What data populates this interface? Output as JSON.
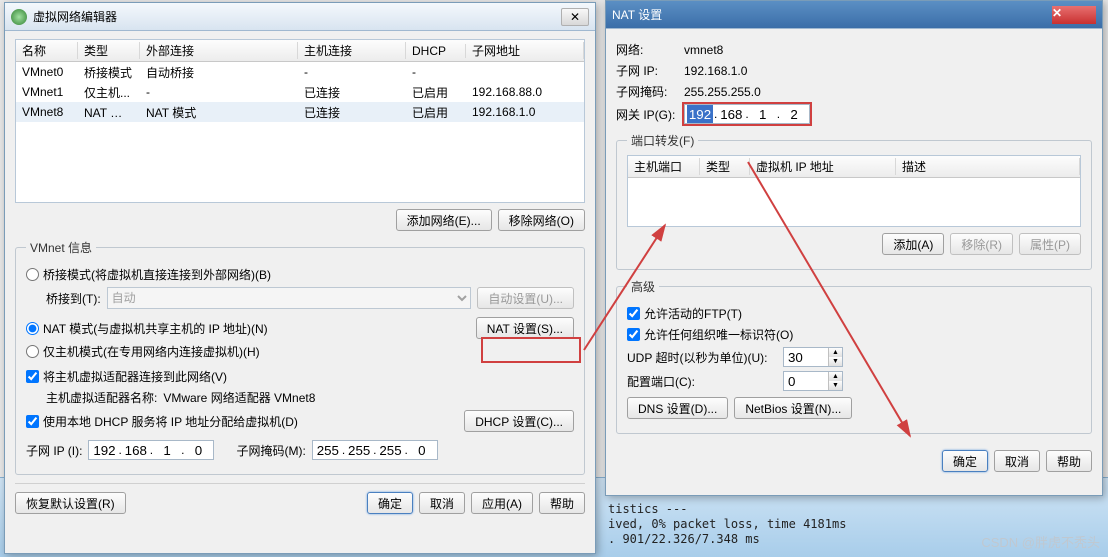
{
  "editor": {
    "title": "虚拟网络编辑器",
    "columns": {
      "name": "名称",
      "type": "类型",
      "ext": "外部连接",
      "host": "主机连接",
      "dhcp": "DHCP",
      "subnet": "子网地址"
    },
    "rows": [
      {
        "name": "VMnet0",
        "type": "桥接模式",
        "ext": "自动桥接",
        "host": "-",
        "dhcp": "-",
        "subnet": ""
      },
      {
        "name": "VMnet1",
        "type": "仅主机...",
        "ext": "-",
        "host": "已连接",
        "dhcp": "已启用",
        "subnet": "192.168.88.0"
      },
      {
        "name": "VMnet8",
        "type": "NAT 模式",
        "ext": "NAT 模式",
        "host": "已连接",
        "dhcp": "已启用",
        "subnet": "192.168.1.0"
      }
    ],
    "add_net": "添加网络(E)...",
    "del_net": "移除网络(O)",
    "info_legend": "VMnet 信息",
    "radio_bridge": "桥接模式(将虚拟机直接连接到外部网络)(B)",
    "bridge_to": "桥接到(T):",
    "bridge_auto": "自动",
    "auto_set": "自动设置(U)...",
    "radio_nat": "NAT 模式(与虚拟机共享主机的 IP 地址)(N)",
    "nat_set": "NAT 设置(S)...",
    "radio_host": "仅主机模式(在专用网络内连接虚拟机)(H)",
    "chk_connect": "将主机虚拟适配器连接到此网络(V)",
    "adapter_name_label": "主机虚拟适配器名称: ",
    "adapter_name_value": "VMware 网络适配器 VMnet8",
    "chk_dhcp": "使用本地 DHCP 服务将 IP 地址分配给虚拟机(D)",
    "dhcp_set": "DHCP 设置(C)...",
    "subnet_ip_label": "子网 IP (I):",
    "subnet_ip": [
      "192",
      "168",
      "1",
      "0"
    ],
    "subnet_mask_label": "子网掩码(M):",
    "subnet_mask": [
      "255",
      "255",
      "255",
      "0"
    ],
    "restore": "恢复默认设置(R)",
    "ok": "确定",
    "cancel": "取消",
    "apply": "应用(A)",
    "help": "帮助"
  },
  "nat": {
    "title": "NAT 设置",
    "net_label": "网络:",
    "net_value": "vmnet8",
    "subip_label": "子网 IP:",
    "subip_value": "192.168.1.0",
    "mask_label": "子网掩码:",
    "mask_value": "255.255.255.0",
    "gw_label": "网关 IP(G):",
    "gw": [
      "192",
      "168",
      "1",
      "2"
    ],
    "pf_legend": "端口转发(F)",
    "pf_cols": {
      "port": "主机端口",
      "type": "类型",
      "ip": "虚拟机 IP 地址",
      "desc": "描述"
    },
    "add": "添加(A)",
    "remove": "移除(R)",
    "props": "属性(P)",
    "adv_legend": "高级",
    "adv_ftp": "允许活动的FTP(T)",
    "adv_org": "允许任何组织唯一标识符(O)",
    "udp_label": "UDP 超时(以秒为单位)(U):",
    "udp_value": "30",
    "cfg_label": "配置端口(C):",
    "cfg_value": "0",
    "dns": "DNS 设置(D)...",
    "netbios": "NetBios 设置(N)...",
    "ok": "确定",
    "cancel": "取消",
    "help": "帮助"
  },
  "console": {
    "l1": "tistics ---",
    "l2": "ived, 0% packet loss, time 4181ms",
    "l3": ". 901/22.326/7.348 ms"
  },
  "watermark": "CSDN @胖虎不秃头"
}
